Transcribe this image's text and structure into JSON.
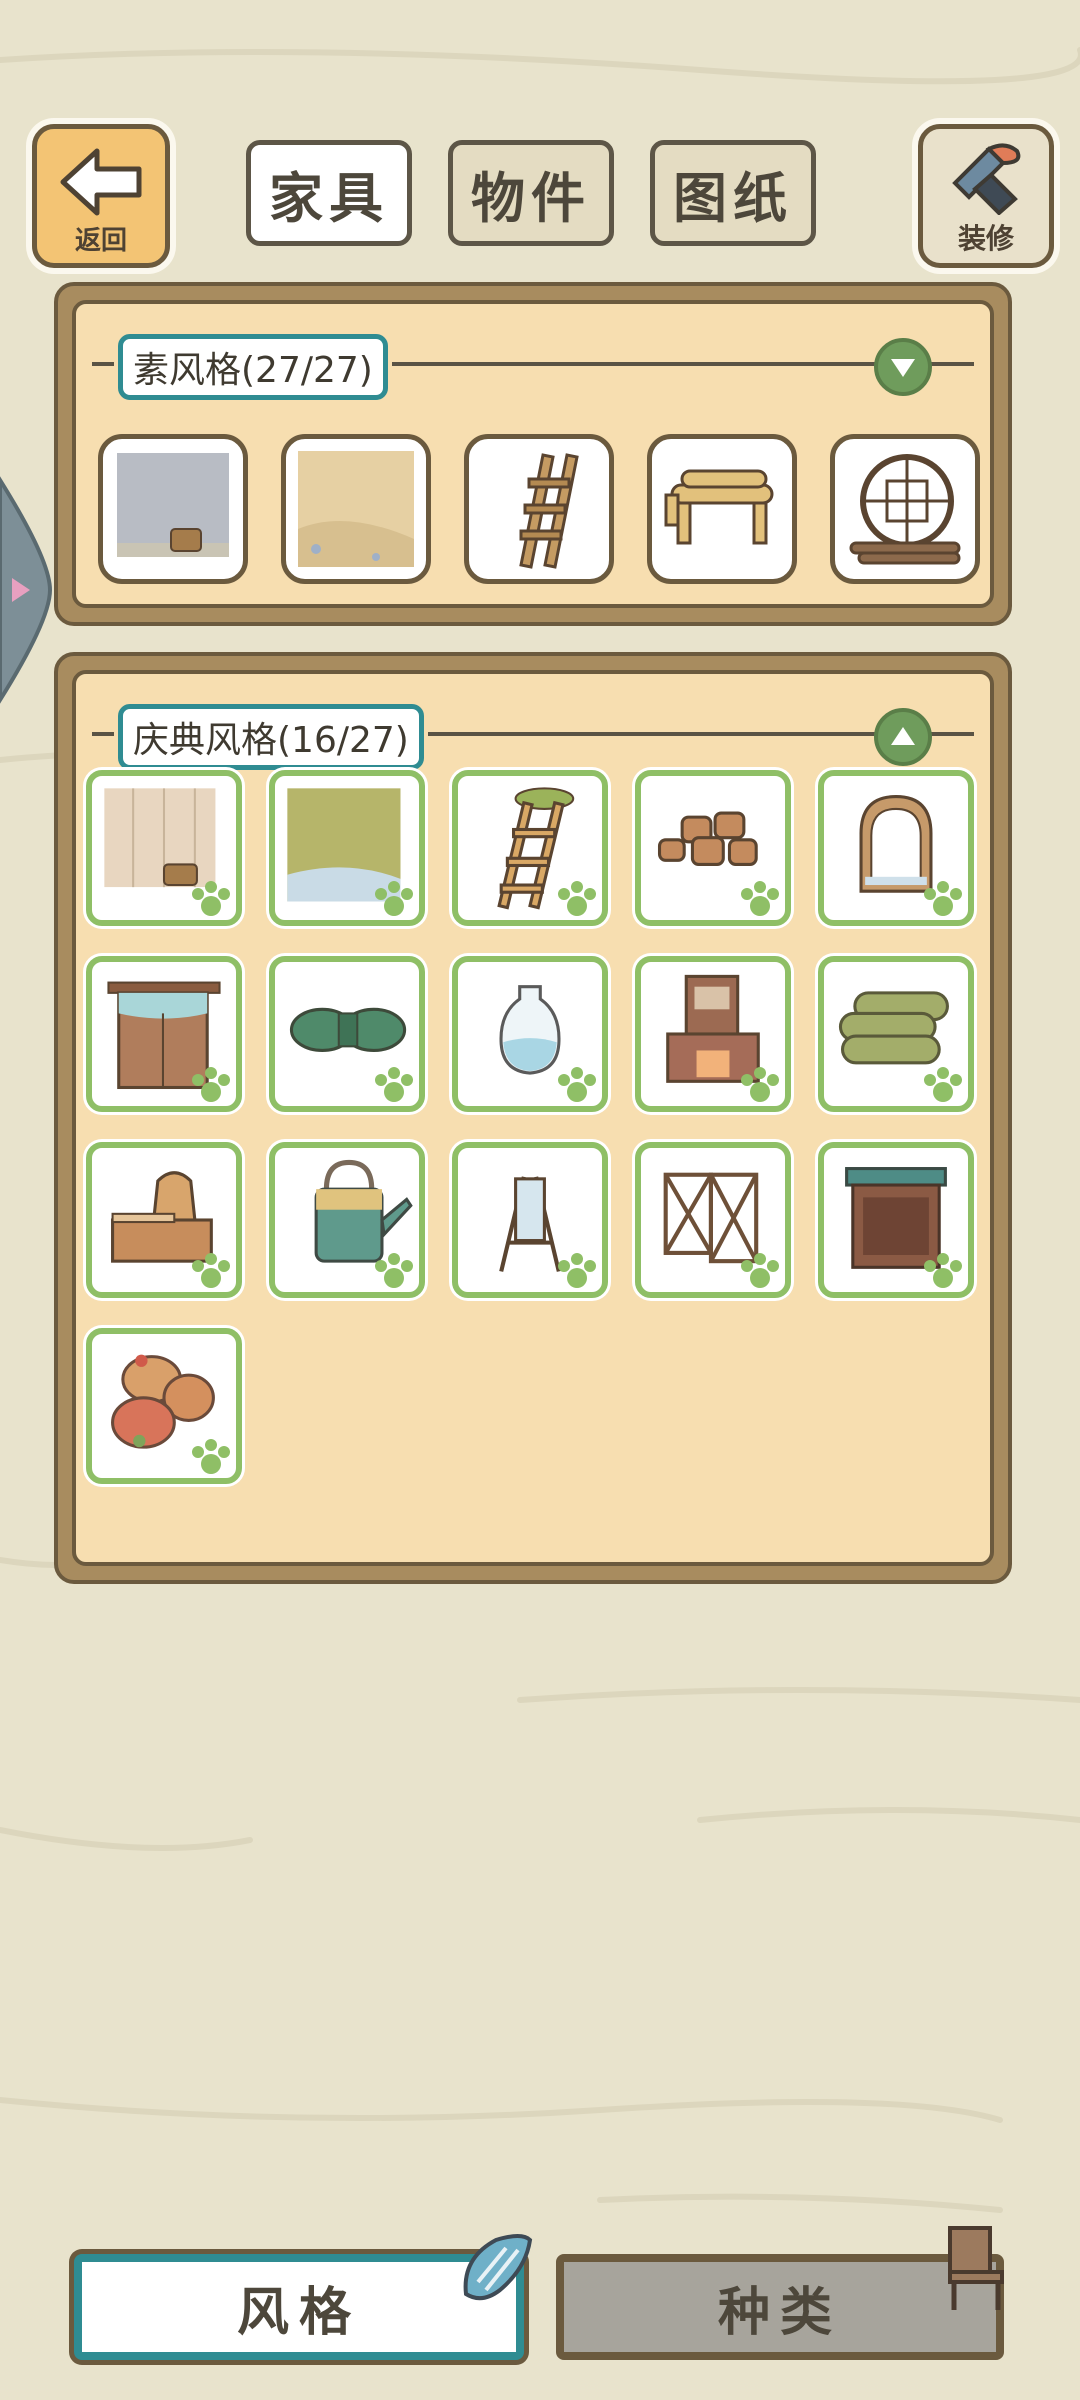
{
  "topbar": {
    "back_label": "返回",
    "tabs": [
      {
        "label": "家具",
        "active": true
      },
      {
        "label": "物件",
        "active": false
      },
      {
        "label": "图纸",
        "active": false
      }
    ],
    "decorate_label": "装修"
  },
  "sections": [
    {
      "title": "素风格(27/27)",
      "expanded": false,
      "items": [
        "wall-floor-wood-grey",
        "ground-sand",
        "wooden-ladder",
        "log-bench",
        "round-lattice-window"
      ]
    },
    {
      "title": "庆典风格(16/27)",
      "expanded": true,
      "items": [
        "wall-floor-plank",
        "ground-grass",
        "grass-ladder",
        "drum-stools",
        "arched-window",
        "curtained-door",
        "bundle-pillow",
        "glass-vase",
        "bookshelf-fireplace",
        "rolled-mats",
        "stove-counter",
        "watering-can",
        "standing-mirror",
        "lattice-screen",
        "teal-cabinet",
        "fruit-sacks"
      ]
    }
  ],
  "bottom": {
    "style_label": "风格",
    "category_label": "种类"
  },
  "colors": {
    "accent_teal": "#2f8c92",
    "panel_fill": "#f7deb0",
    "frame_brown": "#6b5a3e",
    "owned_green": "#8fbf66"
  }
}
